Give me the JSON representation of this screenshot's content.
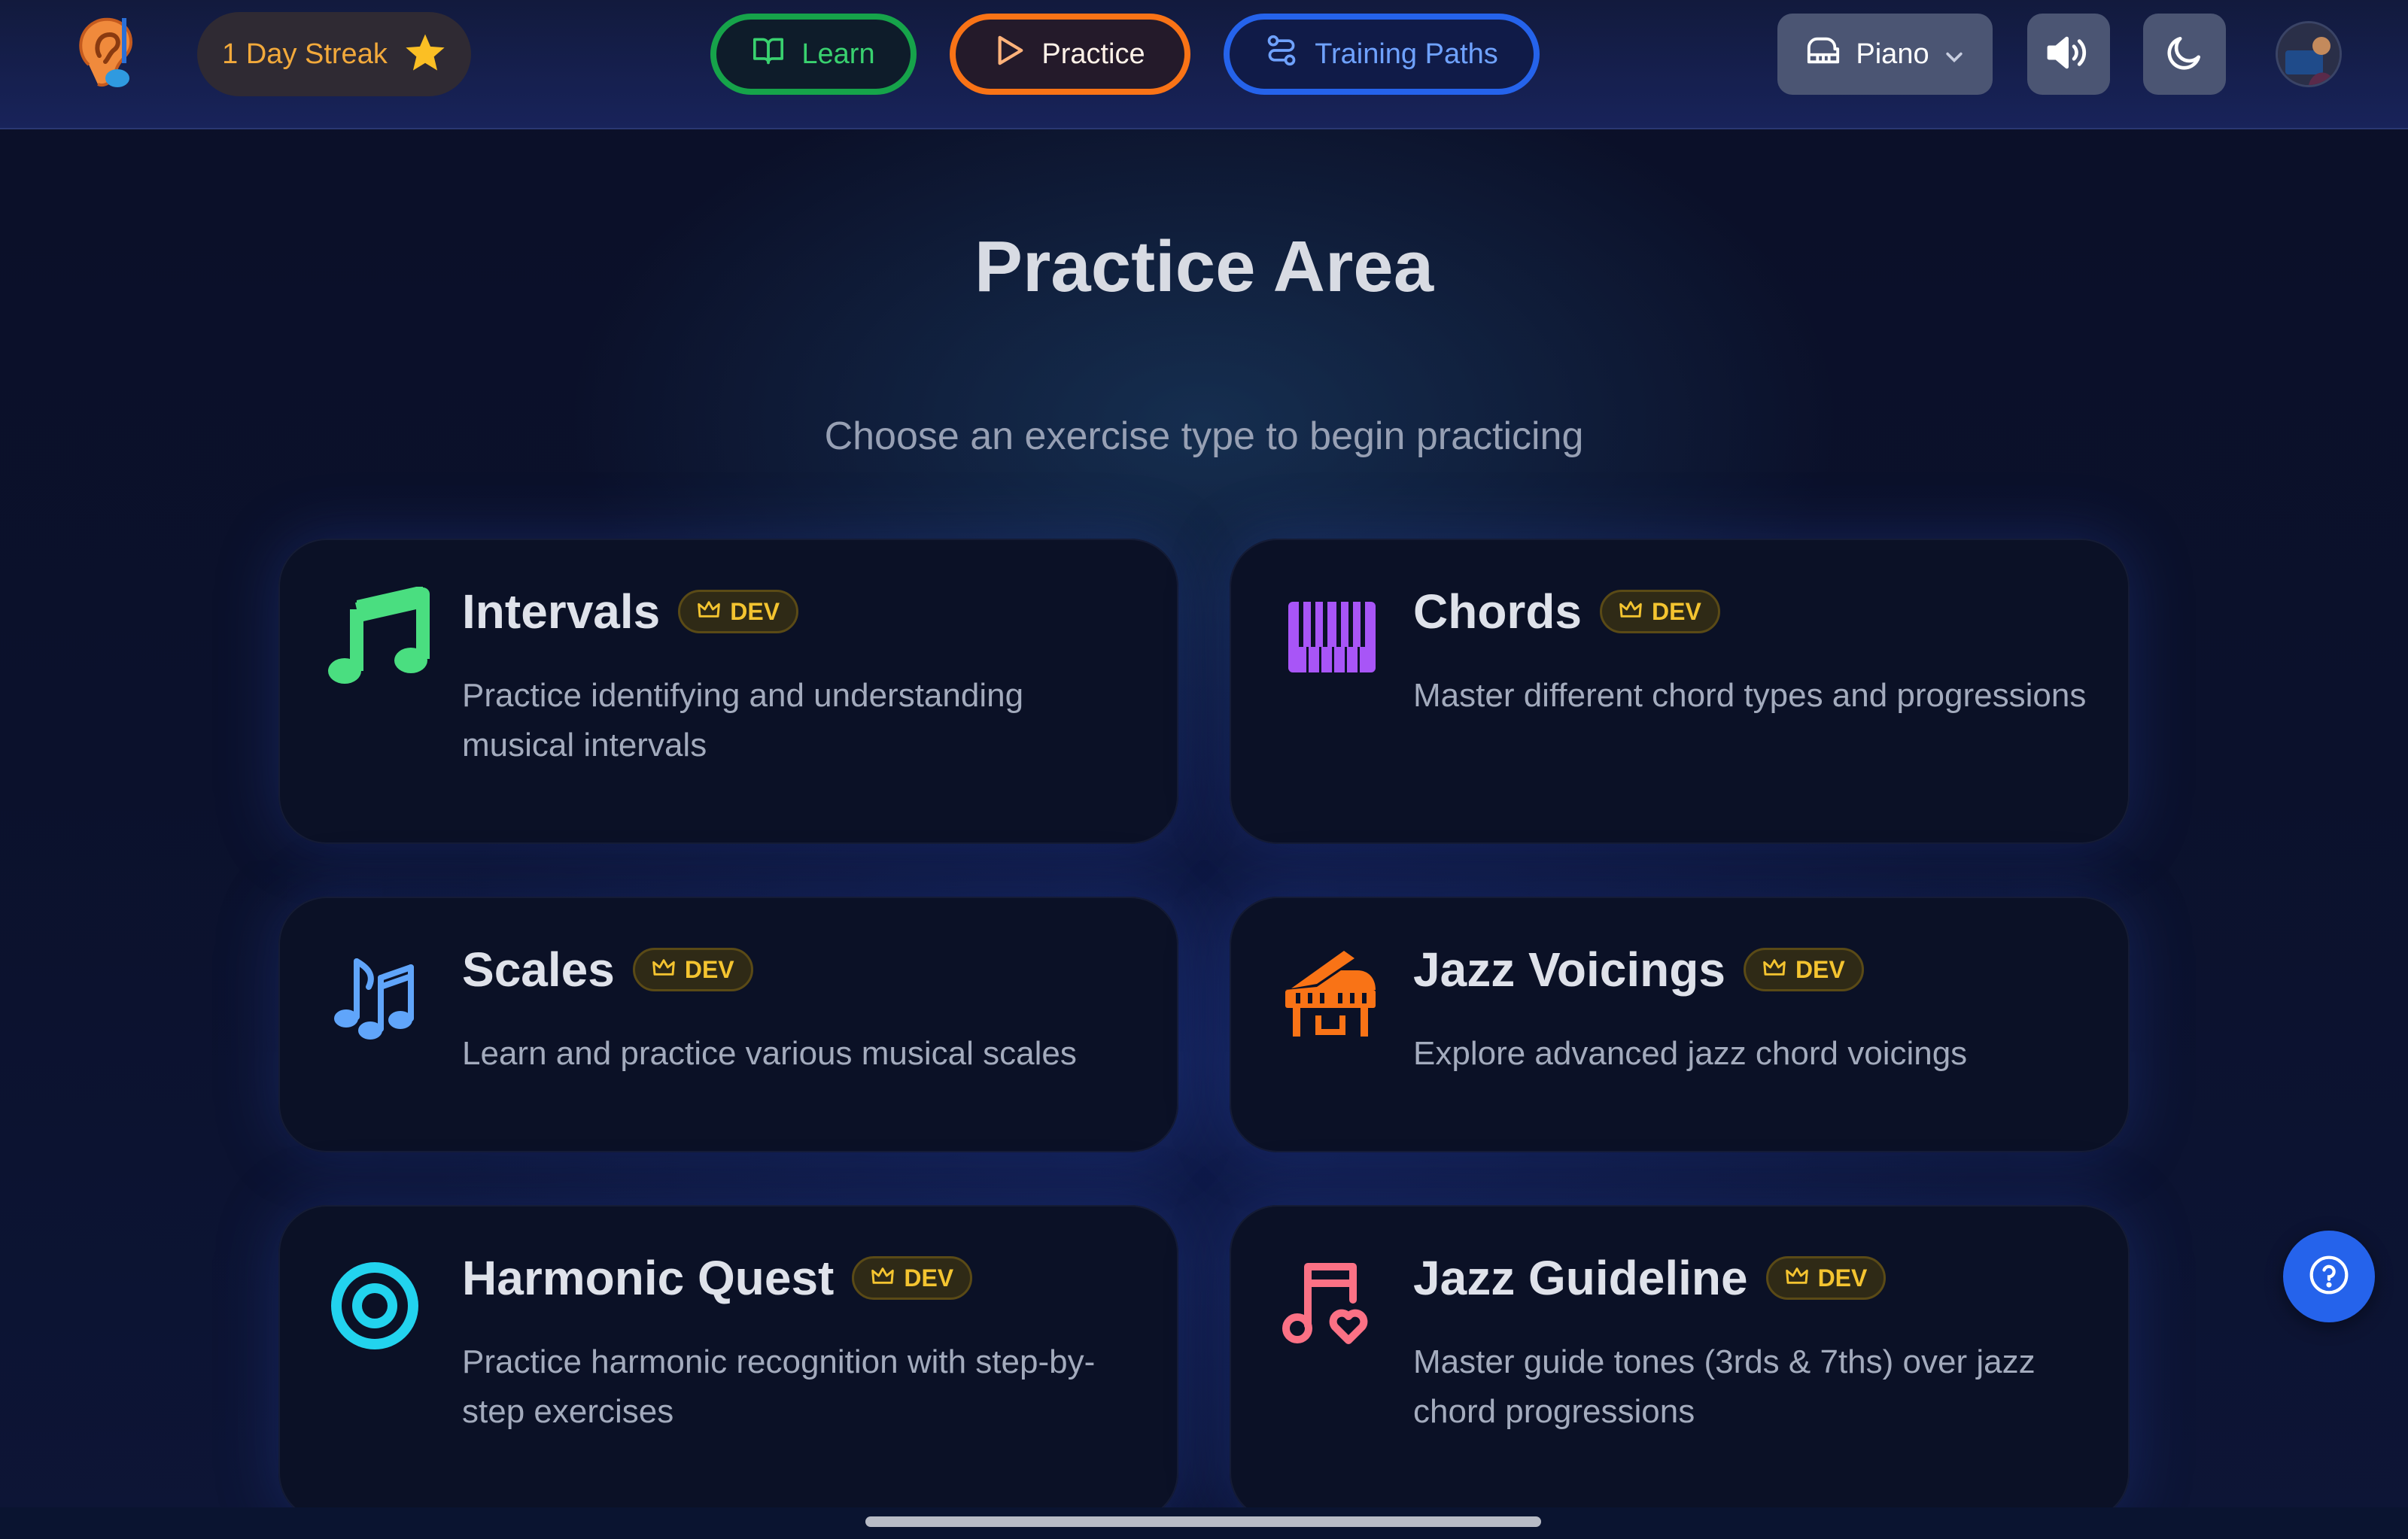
{
  "header": {
    "logo_icon": "ear-music-logo-icon",
    "streak": {
      "label": "1 Day Streak",
      "icon": "star-icon"
    },
    "nav": [
      {
        "label": "Learn",
        "icon": "book-open-icon",
        "color": "#16a34a"
      },
      {
        "label": "Practice",
        "icon": "play-icon",
        "color": "#f97316"
      },
      {
        "label": "Training Paths",
        "icon": "route-icon",
        "color": "#2563eb"
      }
    ],
    "instrument": {
      "label": "Piano",
      "icon": "piano-icon"
    },
    "sound_icon": "speaker-volume-icon",
    "theme_icon": "moon-icon"
  },
  "main": {
    "title": "Practice Area",
    "subtitle": "Choose an exercise type to begin practicing",
    "cards": [
      {
        "title": "Intervals",
        "badge": "DEV",
        "desc": "Practice identifying and understanding musical intervals",
        "icon": "music-note-icon",
        "color": "#4ade80"
      },
      {
        "title": "Chords",
        "badge": "DEV",
        "desc": "Master different chord types and progressions",
        "icon": "piano-keys-icon",
        "color": "#a855f7"
      },
      {
        "title": "Scales",
        "badge": "DEV",
        "desc": "Learn and practice various musical scales",
        "icon": "music-notes-icon",
        "color": "#60a5fa"
      },
      {
        "title": "Jazz Voicings",
        "badge": "DEV",
        "desc": "Explore advanced jazz chord voicings",
        "icon": "grand-piano-icon",
        "color": "#f97316"
      },
      {
        "title": "Harmonic Quest",
        "badge": "DEV",
        "desc": "Practice harmonic recognition with step-by-step exercises",
        "icon": "target-icon",
        "color": "#22d3ee"
      },
      {
        "title": "Jazz Guideline",
        "badge": "DEV",
        "desc": "Master guide tones (3rds & 7ths) over jazz chord progressions",
        "icon": "music-heart-icon",
        "color": "#fb7185"
      }
    ]
  },
  "help_icon": "help-circle-icon"
}
